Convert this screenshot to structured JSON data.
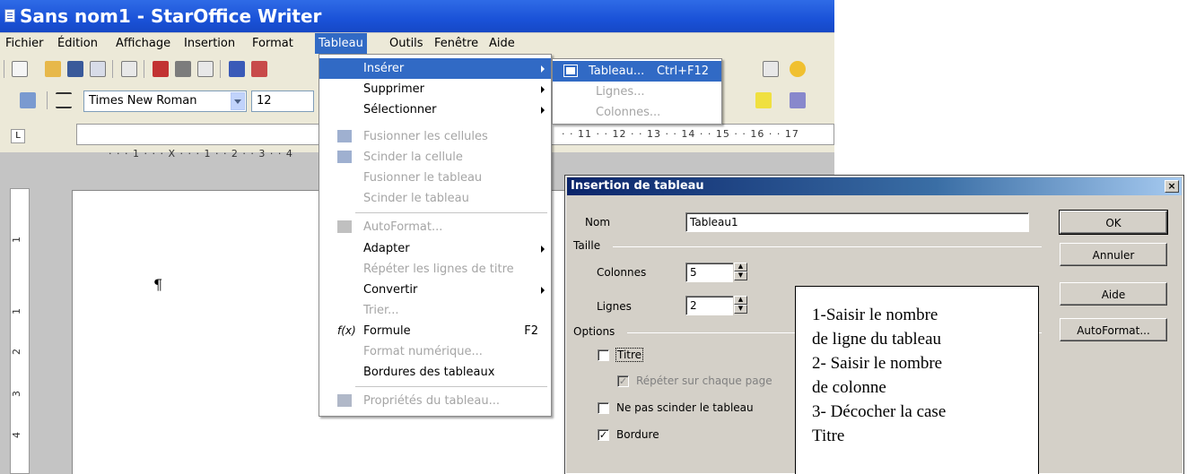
{
  "window": {
    "title": "Sans nom1 - StarOffice Writer"
  },
  "menubar": {
    "items": [
      "Fichier",
      "Édition",
      "Affichage",
      "Insertion",
      "Format",
      "Tableau",
      "Outils",
      "Fenêtre",
      "Aide"
    ],
    "active": "Tableau"
  },
  "formatting": {
    "font_name": "Times New Roman",
    "font_size": "12"
  },
  "ruler": {
    "h_marks": "· · · 1 · · · X · · · 1 · · 2 · · 3 · · 4",
    "h_marks_right": "· · 11 · · 12 · · 13 · · 14 · · 15 · · 16 · · 17",
    "tab_stop": "L",
    "v_marks": [
      "1",
      "1",
      "2",
      "3",
      "4"
    ]
  },
  "document": {
    "paragraph_mark": "¶"
  },
  "tableau_menu": {
    "items": [
      {
        "label": "Insérer",
        "submenu": true,
        "highlighted": true
      },
      {
        "label": "Supprimer",
        "submenu": true
      },
      {
        "label": "Sélectionner",
        "submenu": true
      },
      {
        "label": "Fusionner les cellules",
        "disabled": true
      },
      {
        "label": "Scinder la cellule",
        "disabled": true
      },
      {
        "label": "Fusionner le tableau",
        "disabled": true
      },
      {
        "label": "Scinder le tableau",
        "disabled": true
      },
      {
        "label": "AutoFormat...",
        "disabled": true
      },
      {
        "label": "Adapter",
        "submenu": true
      },
      {
        "label": "Répéter les lignes de titre",
        "disabled": true
      },
      {
        "label": "Convertir",
        "submenu": true
      },
      {
        "label": "Trier...",
        "disabled": true
      },
      {
        "label": "Formule",
        "shortcut": "F2"
      },
      {
        "label": "Format numérique...",
        "disabled": true
      },
      {
        "label": "Bordures des tableaux"
      },
      {
        "label": "Propriétés du tableau...",
        "disabled": true
      }
    ]
  },
  "inserer_submenu": {
    "items": [
      {
        "label": "Tableau...",
        "shortcut": "Ctrl+F12",
        "highlighted": true
      },
      {
        "label": "Lignes...",
        "disabled": true
      },
      {
        "label": "Colonnes...",
        "disabled": true
      }
    ]
  },
  "dialog": {
    "title": "Insertion de tableau",
    "close_label": "×",
    "name_label": "Nom",
    "name_value": "Tableau1",
    "size_group": "Taille",
    "columns_label": "Colonnes",
    "columns_value": "5",
    "rows_label": "Lignes",
    "rows_value": "2",
    "options_group": "Options",
    "title_checkbox": "Titre",
    "title_checked": false,
    "repeat_checkbox": "Répéter sur chaque page",
    "repeat_checked": true,
    "no_split_checkbox": "Ne pas scinder le tableau",
    "no_split_checked": false,
    "border_checkbox": "Bordure",
    "border_checked": true,
    "ok_label": "OK",
    "cancel_label": "Annuler",
    "help_label": "Aide",
    "autoformat_label": "AutoFormat..."
  },
  "annotation": {
    "lines": [
      "1-Saisir le nombre",
      "de ligne du tableau",
      "2- Saisir le nombre",
      "de colonne",
      "3- Décocher la case",
      "Titre"
    ]
  },
  "colors": {
    "titlebar": "#1a52d8",
    "menu_highlight": "#316ac5",
    "dialog_title": "#0a246a",
    "toolbar_bg": "#ece9d8",
    "dialog_bg": "#d4d0c8"
  }
}
